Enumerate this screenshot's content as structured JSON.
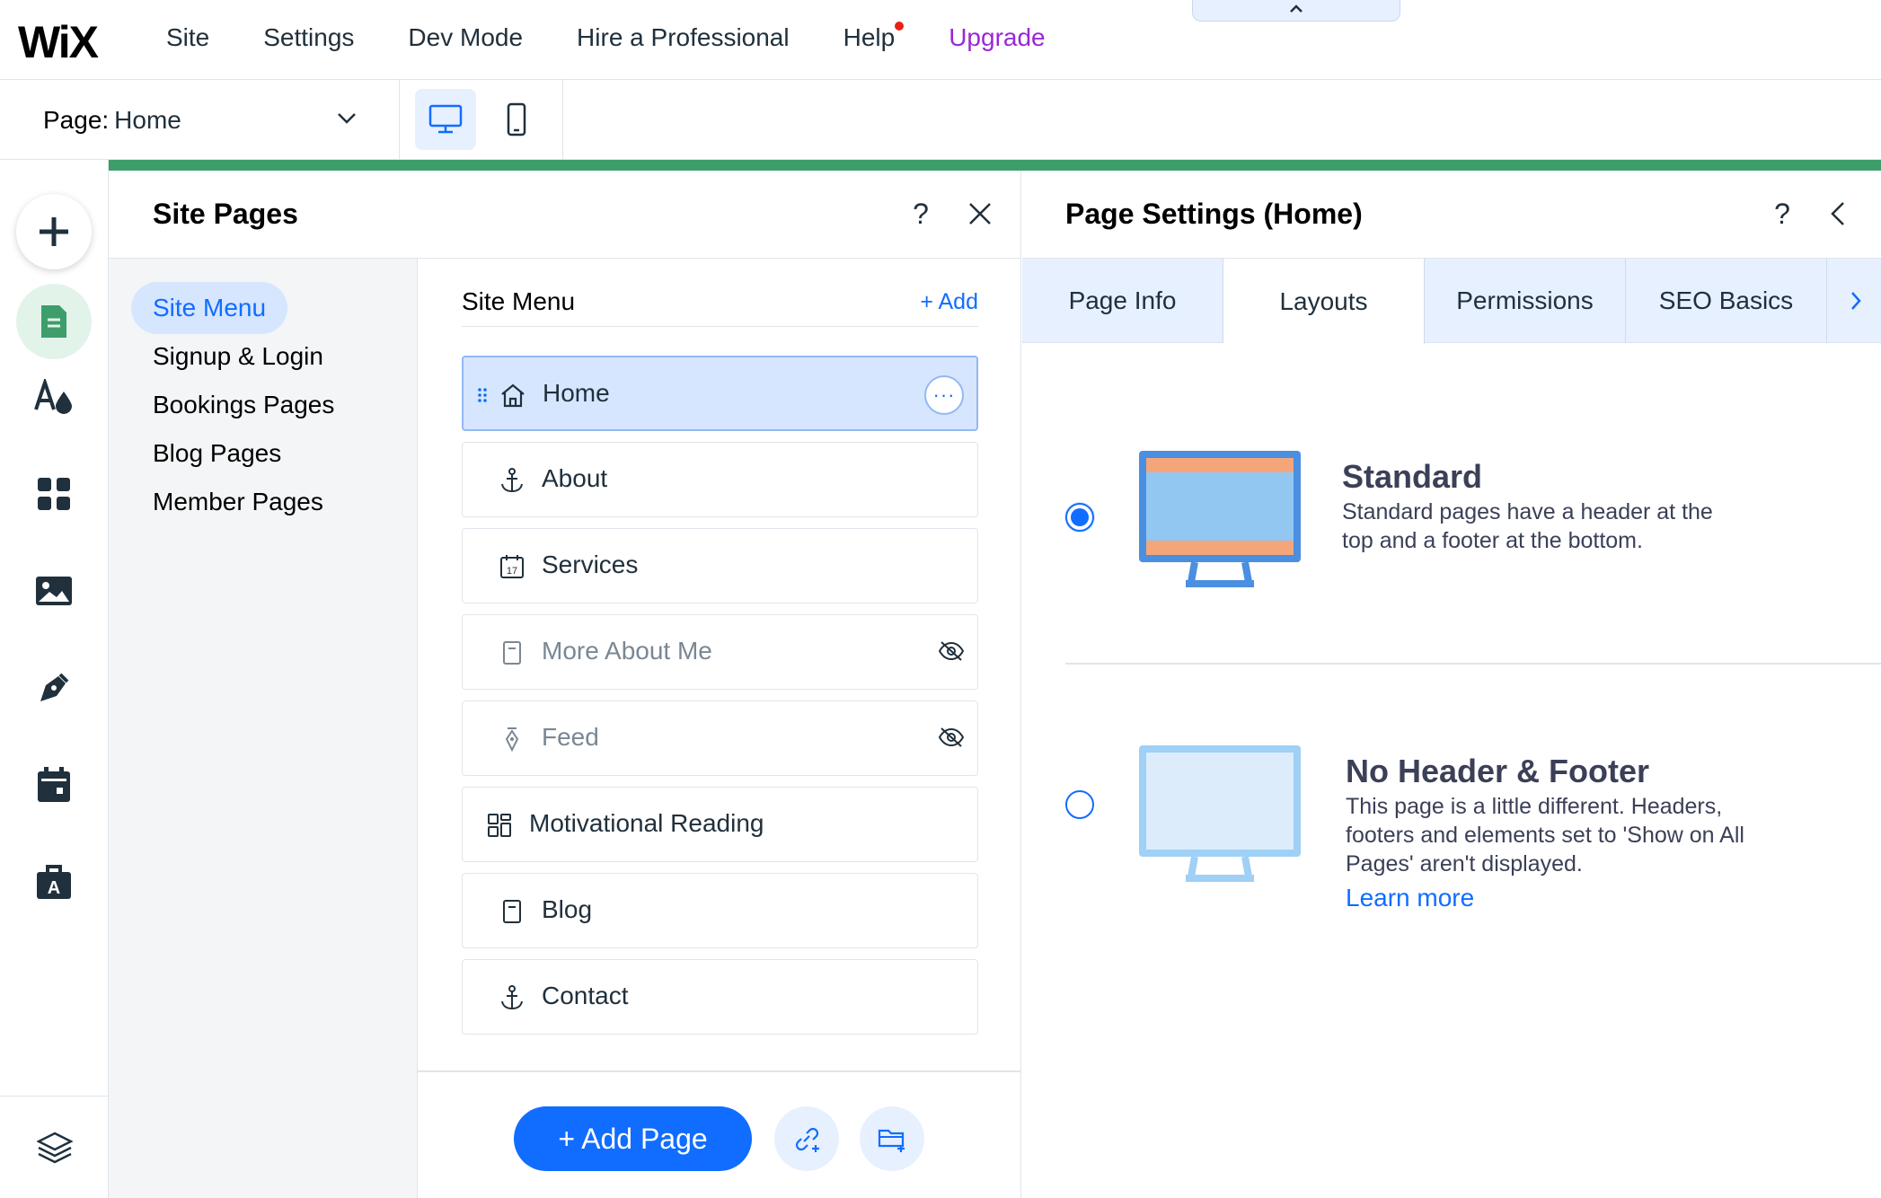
{
  "topbar": {
    "logo": "WiX",
    "nav": [
      "Site",
      "Settings",
      "Dev Mode",
      "Hire a Professional",
      "Help",
      "Upgrade"
    ],
    "collapse_icon": "chevron-up-icon"
  },
  "subbar": {
    "page_label": "Page:",
    "page_value": "Home"
  },
  "site_pages": {
    "title": "Site Pages",
    "categories": [
      "Site Menu",
      "Signup & Login",
      "Bookings Pages",
      "Blog Pages",
      "Member Pages"
    ],
    "list_title": "Site Menu",
    "add_label": "+ Add",
    "pages": [
      {
        "name": "Home",
        "icon": "home-icon",
        "hidden": false
      },
      {
        "name": "About",
        "icon": "anchor-icon",
        "hidden": false
      },
      {
        "name": "Services",
        "icon": "calendar-icon",
        "hidden": false
      },
      {
        "name": "More About Me",
        "icon": "page-icon",
        "hidden": true
      },
      {
        "name": "Feed",
        "icon": "pen-nib-icon",
        "hidden": true
      },
      {
        "name": "Motivational Reading",
        "icon": "dashboard-icon",
        "hidden": false
      },
      {
        "name": "Blog",
        "icon": "page-icon",
        "hidden": false
      },
      {
        "name": "Contact",
        "icon": "anchor-icon",
        "hidden": false
      }
    ],
    "add_page_label": "+ Add Page"
  },
  "page_settings": {
    "title": "Page Settings (Home)",
    "tabs": [
      "Page Info",
      "Layouts",
      "Permissions",
      "SEO Basics"
    ],
    "active_tab": "Layouts",
    "layouts": [
      {
        "title": "Standard",
        "desc": "Standard pages have a header at the top and a footer at the bottom.",
        "selected": true
      },
      {
        "title": "No Header & Footer",
        "desc": "This page is a little different. Headers, footers and elements set to 'Show on All Pages' aren't displayed.",
        "learn_more": "Learn more",
        "selected": false
      }
    ]
  },
  "colors": {
    "accent": "#116dff",
    "green": "#3d9e6b",
    "upgrade": "#9a27d5",
    "help_dot": "#e62214"
  }
}
